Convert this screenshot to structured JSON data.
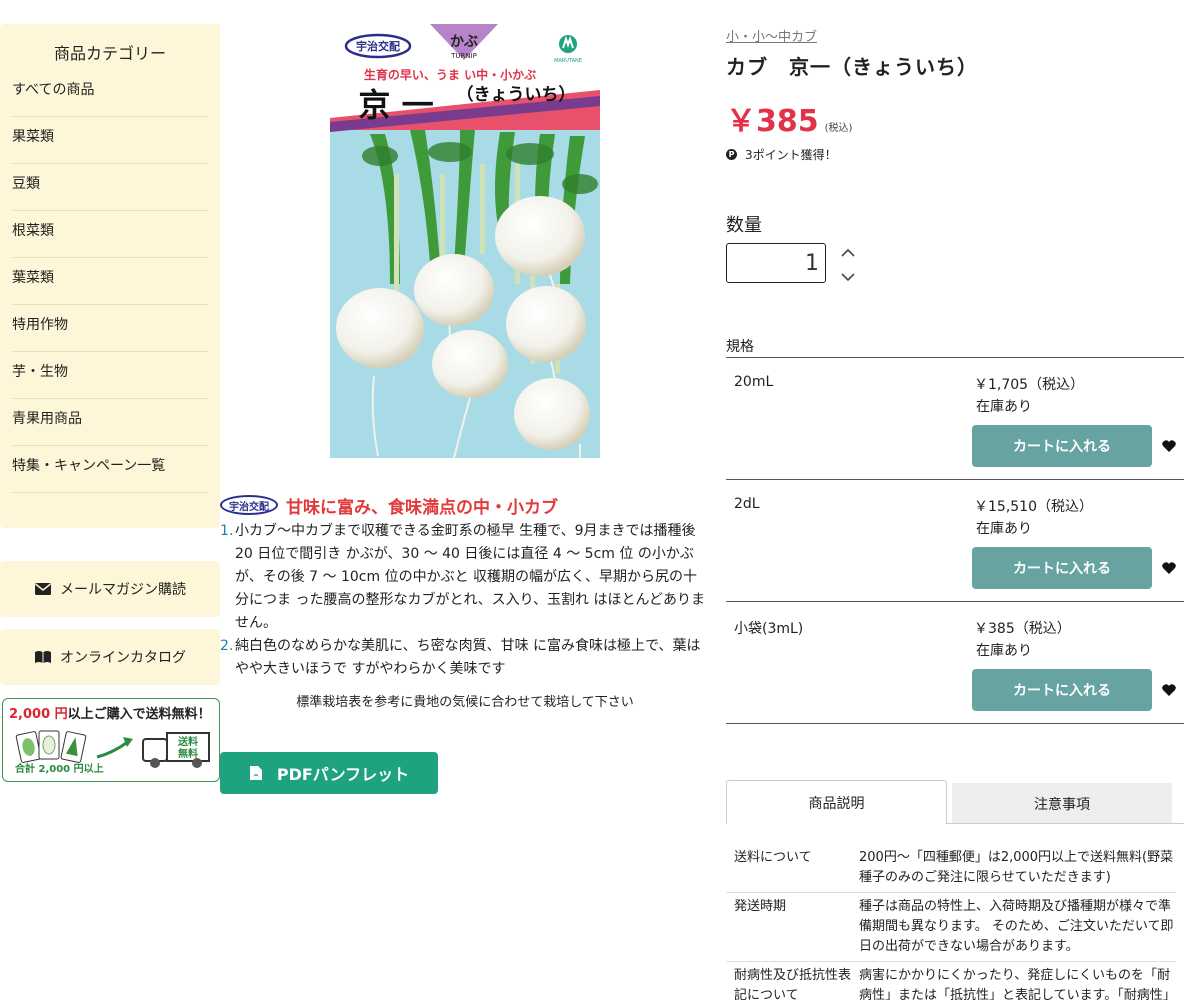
{
  "sidebar": {
    "title": "商品カテゴリー",
    "items": [
      {
        "label": "すべての商品"
      },
      {
        "label": "果菜類"
      },
      {
        "label": "豆類"
      },
      {
        "label": "根菜類"
      },
      {
        "label": "葉菜類"
      },
      {
        "label": "特用作物"
      },
      {
        "label": "芋・生物"
      },
      {
        "label": "青果用商品"
      },
      {
        "label": "特集・キャンペーン一覧"
      }
    ],
    "mail_button": "メールマガジン購読",
    "catalog_button": "オンラインカタログ",
    "banner": {
      "amount": "2,000 円",
      "rest": "以上ご購入で送料無料！",
      "footer": "合計 2,000 円以上",
      "truck_label_1": "送料",
      "truck_label_2": "無料"
    }
  },
  "package": {
    "badge": "宇治交配",
    "crop": "かぶ",
    "crop_en": "TURNIP",
    "maker": "MARUTANE",
    "tagline": "生育の早い、うま い中・小かぶ",
    "name": "京 一",
    "reading": "（きょういち）"
  },
  "description": {
    "badge": "宇治交配",
    "heading": "甘味に富み、食味満点の中・小カブ",
    "points": [
      {
        "num": "1.",
        "text": "小カブ〜中カブまで収穫できる金町系の極早 生種で、9月まきでは播種後 20 日位で間引き かぶが、30 〜 40 日後には直径 4 〜 5cm 位 の小かぶが、その後 7 〜 10cm 位の中かぶと 収穫期の幅が広く、早期から尻の十分につま った腰高の整形なカブがとれ、ス入り、玉割れ はほとんどありません。"
      },
      {
        "num": "2.",
        "text": "純白色のなめらかな美肌に、ち密な肉質、甘味 に富み食味は極上で、葉はやや大きいほうで すがやわらかく美味です"
      }
    ],
    "note": "標準栽培表を参考に貴地の気候に合わせて栽培して下さい"
  },
  "pdf_button": "PDFパンフレット",
  "product": {
    "breadcrumb": "小・小〜中カブ",
    "title": "カブ　京一（きょういち）",
    "price": "￥385",
    "tax_note": "(税込)",
    "points_icon": "P",
    "points": "3ポイント獲得！"
  },
  "quantity": {
    "label": "数量",
    "value": "1"
  },
  "spec": {
    "label": "規格",
    "rows": [
      {
        "name": "20mL",
        "price": "￥1,705（税込）",
        "stock": "在庫あり",
        "cart": "カートに入れる"
      },
      {
        "name": "2dL",
        "price": "￥15,510（税込）",
        "stock": "在庫あり",
        "cart": "カートに入れる"
      },
      {
        "name": "小袋(3mL)",
        "price": "￥385（税込）",
        "stock": "在庫あり",
        "cart": "カートに入れる"
      }
    ]
  },
  "tabs": [
    {
      "label": "商品説明",
      "active": true
    },
    {
      "label": "注意事項",
      "active": false
    }
  ],
  "info": [
    {
      "key": "送料について",
      "value": "200円〜「四種郵便」は2,000円以上で送料無料(野菜種子のみのご発注に限らせていただきます)"
    },
    {
      "key": "発送時期",
      "value": "種子は商品の特性上、入荷時期及び播種期が様々で準備期間も異なります。 そのため、ご注文いただいて即日の出荷ができない場合があります。"
    },
    {
      "key": "耐病性及び抵抗性表記について",
      "value": "病害にかかりにくかったり、発症しにくいものを「耐病性」または「抵抗性」と表記しています。「耐病性」"
    }
  ],
  "colors": {
    "sidebar_bg": "#fdf6d8",
    "price_red": "#e0334a",
    "cart_teal": "#66a3a1",
    "pdf_green": "#1ea27f",
    "heading_red": "#e23a3a"
  }
}
